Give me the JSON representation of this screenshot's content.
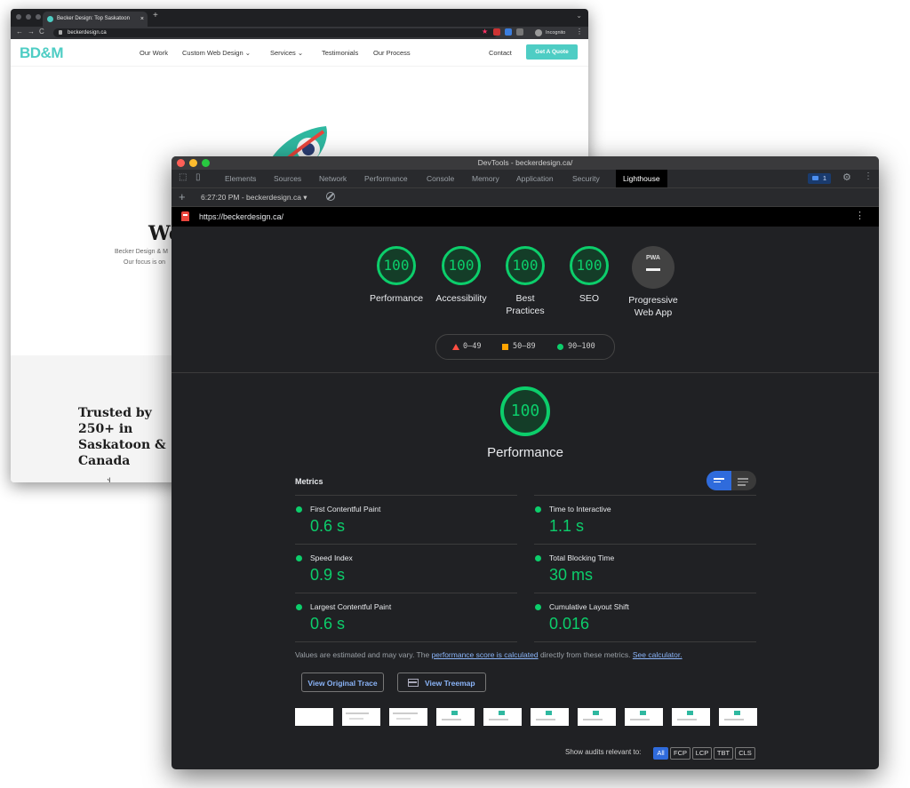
{
  "browser": {
    "tab_title": "Becker Design: Top Saskatoon",
    "tab_close": "×",
    "new_tab": "+",
    "url": "beckerdesign.ca",
    "incognito": "Incognito"
  },
  "site": {
    "logo": "BD&M",
    "nav": [
      "Our Work",
      "Custom Web Design ⌄",
      "Services ⌄",
      "Testimonials",
      "Our Process"
    ],
    "contact": "Contact",
    "cta": "Get A Quote",
    "hero_heading": "We",
    "hero_line1": "Becker Design & M",
    "hero_line2": "Our focus is on",
    "trusted": "Trusted by 250+ in Saskatoon & Canada"
  },
  "devtools": {
    "title": "DevTools - beckerdesign.ca/",
    "tabs": [
      "Elements",
      "Sources",
      "Network",
      "Performance",
      "Console",
      "Memory",
      "Application",
      "Security",
      "Lighthouse"
    ],
    "issues_count": "1",
    "report_selector": "6:27:20 PM - beckerdesign.ca ▾",
    "report_url": "https://beckerdesign.ca/"
  },
  "scores": [
    {
      "value": "100",
      "label": "Performance"
    },
    {
      "value": "100",
      "label": "Accessibility"
    },
    {
      "value": "100",
      "label": "Best Practices"
    },
    {
      "value": "100",
      "label": "SEO"
    }
  ],
  "pwa": {
    "badge": "PWA",
    "label": "Progressive Web App"
  },
  "legend": {
    "low": "0–49",
    "mid": "50–89",
    "high": "90–100"
  },
  "performance": {
    "score": "100",
    "label": "Performance"
  },
  "metrics": {
    "title": "Metrics",
    "items": [
      {
        "name": "First Contentful Paint",
        "value": "0.6 s"
      },
      {
        "name": "Time to Interactive",
        "value": "1.1 s"
      },
      {
        "name": "Speed Index",
        "value": "0.9 s"
      },
      {
        "name": "Total Blocking Time",
        "value": "30 ms"
      },
      {
        "name": "Largest Contentful Paint",
        "value": "0.6 s"
      },
      {
        "name": "Cumulative Layout Shift",
        "value": "0.016"
      }
    ]
  },
  "note": {
    "prefix": "Values are estimated and may vary. The ",
    "link1": "performance score is calculated",
    "middle": " directly from these metrics. ",
    "link2": "See calculator."
  },
  "buttons": {
    "trace": "View Original Trace",
    "treemap": "View Treemap"
  },
  "filter": {
    "label": "Show audits relevant to:",
    "chips": [
      "All",
      "FCP",
      "LCP",
      "TBT",
      "CLS"
    ]
  },
  "colors": {
    "pass": "#0cce6b",
    "average": "#ffa400",
    "fail": "#ff4e42",
    "accent": "#4ecdc4"
  }
}
